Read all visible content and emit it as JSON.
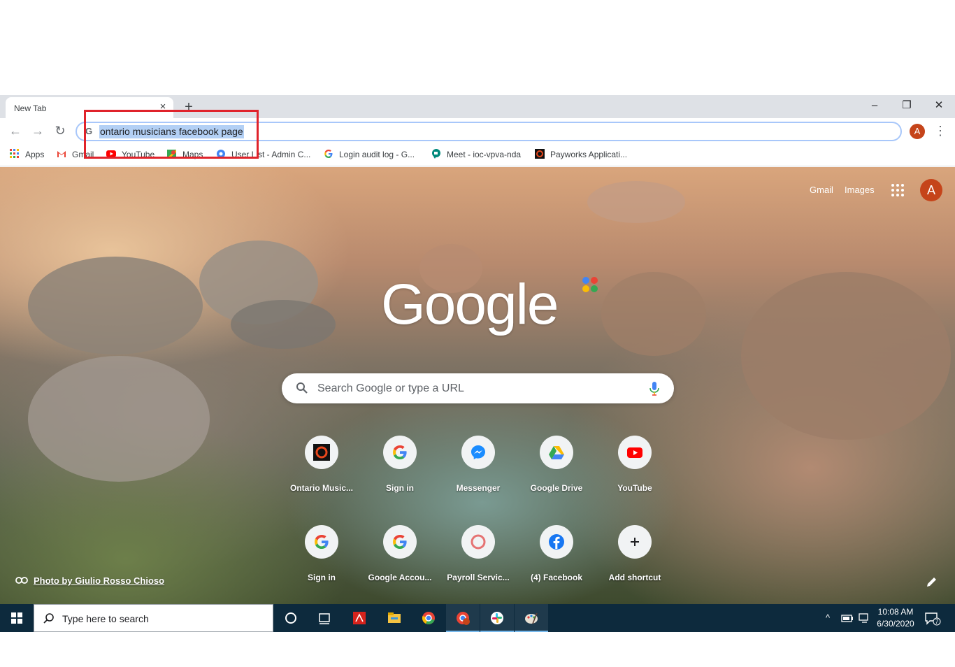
{
  "browser": {
    "tab_title": "New Tab",
    "tab_close": "×",
    "new_tab": "+",
    "window_controls": {
      "minimize": "–",
      "restore": "❐",
      "close": "✕"
    },
    "nav": {
      "back": "←",
      "forward": "→",
      "reload": "↻"
    },
    "omnibox_icon": "G",
    "omnibox_text": "ontario musicians facebook page",
    "profile_initial": "A",
    "menu": "⋮"
  },
  "bookmarks": [
    {
      "label": "Apps",
      "icon": "apps-grid-icon"
    },
    {
      "label": "Gmail",
      "icon": "gmail-icon"
    },
    {
      "label": "YouTube",
      "icon": "youtube-icon"
    },
    {
      "label": "Maps",
      "icon": "maps-icon"
    },
    {
      "label": "User List - Admin C...",
      "icon": "admin-icon"
    },
    {
      "label": "Login audit log - G...",
      "icon": "google-icon"
    },
    {
      "label": "Meet - ioc-vpva-nda",
      "icon": "meet-icon"
    },
    {
      "label": "Payworks Applicati...",
      "icon": "payworks-icon"
    }
  ],
  "ntp": {
    "gmail": "Gmail",
    "images": "Images",
    "avatar_initial": "A",
    "logo": "Google",
    "search_placeholder": "Search Google or type a URL",
    "shortcuts_row1": [
      {
        "label": "Ontario Music...",
        "icon": "ontario-music-icon"
      },
      {
        "label": "Sign in",
        "icon": "google-icon"
      },
      {
        "label": "Messenger",
        "icon": "messenger-icon"
      },
      {
        "label": "Google Drive",
        "icon": "drive-icon"
      },
      {
        "label": "YouTube",
        "icon": "youtube-icon"
      }
    ],
    "shortcuts_row2": [
      {
        "label": "Sign in",
        "icon": "google-icon"
      },
      {
        "label": "Google Accou...",
        "icon": "google-icon"
      },
      {
        "label": "Payroll Servic...",
        "icon": "payroll-icon"
      },
      {
        "label": "(4) Facebook",
        "icon": "facebook-icon"
      },
      {
        "label": "Add shortcut",
        "icon": "plus-icon"
      }
    ],
    "photo_credit": "Photo by Giulio Rosso Chioso"
  },
  "taskbar": {
    "search_placeholder": "Type here to search",
    "time": "10:08 AM",
    "date": "6/30/2020",
    "tray_arrow": "^",
    "notifications_count": "7"
  },
  "colors": {
    "highlight_box": "#e0232b",
    "avatar": "#c5441a",
    "taskbar": "#0d2a3d"
  }
}
